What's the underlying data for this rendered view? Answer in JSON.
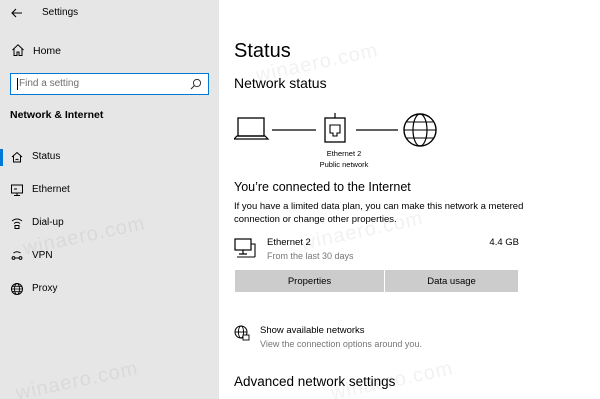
{
  "window": {
    "app_title": "Settings"
  },
  "sidebar": {
    "home_label": "Home",
    "search_placeholder": "Find a setting",
    "section_title": "Network & Internet",
    "items": [
      {
        "label": "Status",
        "icon": "home-network-icon",
        "active": true
      },
      {
        "label": "Ethernet",
        "icon": "ethernet-icon",
        "active": false
      },
      {
        "label": "Dial-up",
        "icon": "dialup-icon",
        "active": false
      },
      {
        "label": "VPN",
        "icon": "vpn-icon",
        "active": false
      },
      {
        "label": "Proxy",
        "icon": "globe-icon",
        "active": false
      }
    ]
  },
  "main": {
    "title": "Status",
    "network_status_heading": "Network status",
    "diagram": {
      "adapter_name": "Ethernet 2",
      "network_type": "Public network"
    },
    "connected_heading": "You’re connected to the Internet",
    "description": "If you have a limited data plan, you can make this network a metered connection or change other properties.",
    "connection": {
      "name": "Ethernet 2",
      "usage": "4.4 GB",
      "period": "From the last 30 days"
    },
    "buttons": {
      "properties": "Properties",
      "data_usage": "Data usage"
    },
    "show_networks": {
      "title": "Show available networks",
      "subtitle": "View the connection options around you."
    },
    "advanced_heading": "Advanced network settings"
  },
  "watermark": "winaero.com",
  "colors": {
    "accent": "#0078d7",
    "sidebar_bg": "#e6e6e6",
    "button_bg": "#cccccc",
    "secondary_text": "#767676"
  }
}
